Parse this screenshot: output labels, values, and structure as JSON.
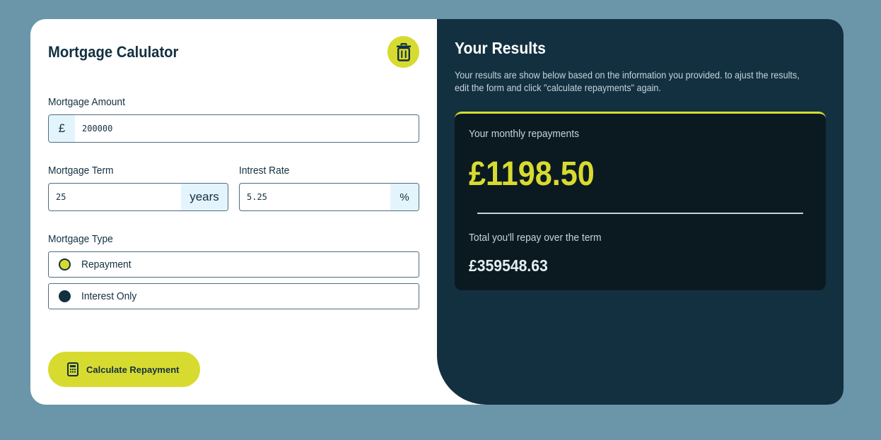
{
  "calculator": {
    "title": "Mortgage Calulator",
    "clear_icon": "trash-icon",
    "amount": {
      "label": "Mortgage Amount",
      "prefix": "£",
      "value": "200000"
    },
    "term": {
      "label": "Mortgage Term",
      "value": "25",
      "suffix": "years"
    },
    "rate": {
      "label": "Intrest Rate",
      "value": "5.25",
      "suffix": "%"
    },
    "type": {
      "label": "Mortgage Type",
      "options": [
        {
          "label": "Repayment",
          "selected": true
        },
        {
          "label": "Interest Only",
          "selected": false
        }
      ]
    },
    "submit": {
      "label": "Calculate Repayment",
      "icon": "calculator-icon"
    }
  },
  "results": {
    "title": "Your Results",
    "description": "Your results are show below based on the information you provided. to ajust the results, edit the form and click \"calculate repayments\" again.",
    "monthly_label": "Your monthly repayments",
    "monthly_value": "£1198.50",
    "total_label": "Total you'll repay over the term",
    "total_value": "£359548.63"
  },
  "colors": {
    "background": "#6b95a9",
    "accent": "#d8db2f",
    "dark": "#133041",
    "results_box": "#0b1a21"
  }
}
